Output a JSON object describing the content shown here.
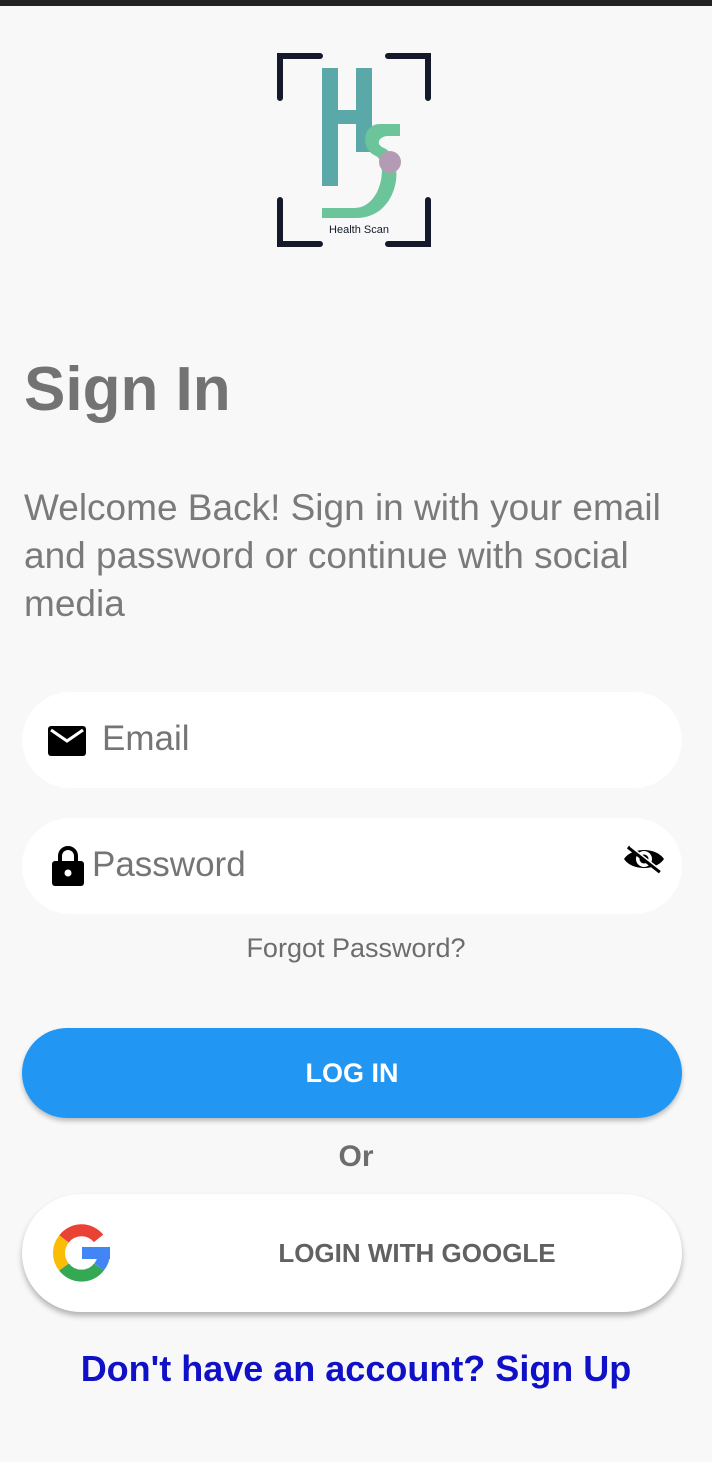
{
  "logo": {
    "name": "health-scan-logo",
    "tagline": "Health Scan"
  },
  "header": {
    "title": "Sign In",
    "subtitle": "Welcome Back! Sign in with your email and password or continue with social media"
  },
  "form": {
    "email": {
      "placeholder": "Email",
      "icon": "mail-icon"
    },
    "password": {
      "placeholder": "Password",
      "icon": "lock-icon",
      "toggle_icon": "eye-hidden-icon"
    },
    "forgot_label": "Forgot Password?",
    "login_label": "LOG IN",
    "or_label": "Or",
    "google_label": "LOGIN WITH GOOGLE",
    "signup_label": "Don't have an account? Sign Up"
  },
  "colors": {
    "primary": "#2196f3",
    "link": "#1010c8",
    "logo_teal": "#5aa8a8",
    "logo_green": "#6cc49a",
    "logo_dot": "#b49bb4"
  }
}
